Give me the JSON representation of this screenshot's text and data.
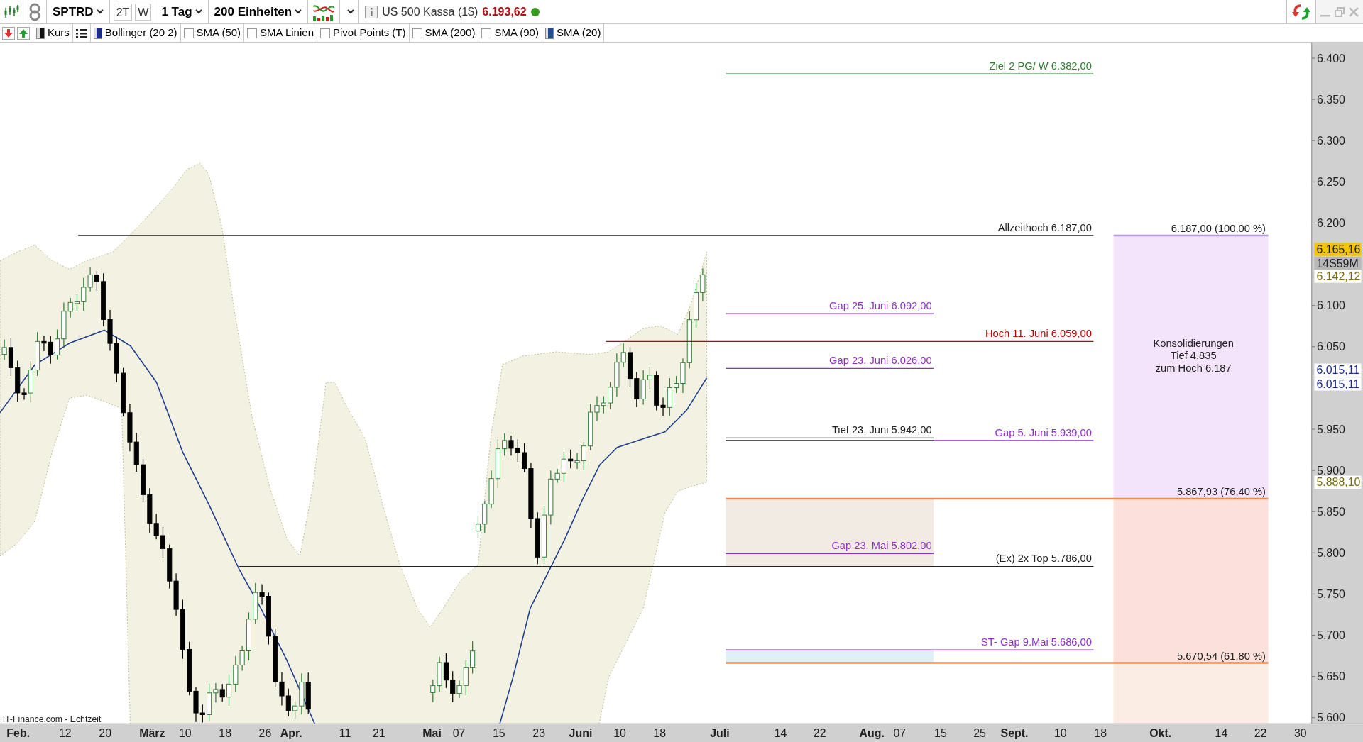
{
  "toolbar": {
    "symbol": "SPTRD",
    "buttons": [
      "2T",
      "W"
    ],
    "interval": "1 Tag",
    "range": "200 Einheiten",
    "instrument": "US 500 Kassa (1$)",
    "price": "6.193,62",
    "status_dot": {
      "color": "#3a9a1e"
    }
  },
  "indicator_bar": [
    {
      "kind": "swatch",
      "label": "Kurs",
      "color": "#111111"
    },
    {
      "kind": "list"
    },
    {
      "kind": "swatch",
      "label": "Bollinger (20 2)",
      "color": "#1c2a8a"
    },
    {
      "kind": "checkbox",
      "label": "SMA (50)",
      "checked": false
    },
    {
      "kind": "checkbox",
      "label": "SMA Linien",
      "checked": false
    },
    {
      "kind": "checkbox",
      "label": "Pivot Points (T)",
      "checked": false
    },
    {
      "kind": "checkbox",
      "label": "SMA (200)",
      "checked": false
    },
    {
      "kind": "checkbox",
      "label": "SMA (90)",
      "checked": false
    },
    {
      "kind": "swatch",
      "label": "SMA (20)",
      "color": "#1f4e8c"
    }
  ],
  "chart": {
    "source": "IT-Finance.com - Echtzeit",
    "annotations": [
      {
        "label": "Ziel 2 PG/ W  6.382,00",
        "color": "#2e7d32"
      },
      {
        "label": "Allzeithoch  6.187,00",
        "color": "#222222"
      },
      {
        "label": "Gap 25. Juni  6.092,00",
        "color": "#8e2fc9"
      },
      {
        "label": "Hoch 11. Juni 6.059,00",
        "color": "#c00000"
      },
      {
        "label": "Gap 23. Juni 6.026,00",
        "color": "#8e2fc9"
      },
      {
        "label": "Tief 23. Juni 5.942,00",
        "color": "#222222"
      },
      {
        "label": "Gap 5. Juni 5.939,00",
        "color": "#8e2fc9"
      },
      {
        "label": "Gap 23. Mai 5.802,00",
        "color": "#8e2fc9"
      },
      {
        "label": "(Ex) 2x Top  5.786,00",
        "color": "#222222"
      },
      {
        "label": "ST- Gap 9.Mai 5.686,00",
        "color": "#8e2fc9"
      }
    ],
    "fib_levels": [
      {
        "label": "6.187,00 (100,00 %)",
        "color": "#b59ad8"
      },
      {
        "label": "5.867,93 (76,40 %)",
        "color": "#f08a4b"
      },
      {
        "label": "5.670,54 (61,80 %)",
        "color": "#f08a4b"
      }
    ],
    "zone_note": [
      "Konsolidierungen",
      "Tief 4.835",
      "zum Hoch 6.187"
    ],
    "price_axis": [
      "6.400",
      "6.350",
      "6.300",
      "6.250",
      "6.200",
      "6.100",
      "6.050",
      "5.950",
      "5.900",
      "5.850",
      "5.800",
      "5.750",
      "5.700",
      "5.650",
      "5.600"
    ],
    "price_tags": [
      {
        "kind": "last",
        "text": "6.165,16"
      },
      {
        "kind": "timer",
        "text": "14S59M"
      },
      {
        "kind": "band",
        "text": "6.142,12"
      },
      {
        "kind": "sma",
        "text": "6.015,11"
      },
      {
        "kind": "sma",
        "text": "6.015,11"
      },
      {
        "kind": "band",
        "text": "5.888,10"
      }
    ],
    "time_axis": [
      {
        "text": "Feb.",
        "major": true
      },
      {
        "text": "12",
        "major": false
      },
      {
        "text": "20",
        "major": false
      },
      {
        "text": "März",
        "major": true
      },
      {
        "text": "10",
        "major": false
      },
      {
        "text": "18",
        "major": false
      },
      {
        "text": "26",
        "major": false
      },
      {
        "text": "Apr.",
        "major": true
      },
      {
        "text": "11",
        "major": false
      },
      {
        "text": "21",
        "major": false
      },
      {
        "text": "Mai",
        "major": true
      },
      {
        "text": "07",
        "major": false
      },
      {
        "text": "15",
        "major": false
      },
      {
        "text": "23",
        "major": false
      },
      {
        "text": "Juni",
        "major": true
      },
      {
        "text": "10",
        "major": false
      },
      {
        "text": "18",
        "major": false
      },
      {
        "text": "Juli",
        "major": true
      },
      {
        "text": "14",
        "major": false
      },
      {
        "text": "22",
        "major": false
      },
      {
        "text": "Aug.",
        "major": true
      },
      {
        "text": "07",
        "major": false
      },
      {
        "text": "15",
        "major": false
      },
      {
        "text": "25",
        "major": false
      },
      {
        "text": "Sept.",
        "major": true
      },
      {
        "text": "10",
        "major": false
      },
      {
        "text": "18",
        "major": false
      },
      {
        "text": "Okt.",
        "major": true
      },
      {
        "text": "14",
        "major": false
      },
      {
        "text": "22",
        "major": false
      },
      {
        "text": "30",
        "major": false
      }
    ]
  }
}
